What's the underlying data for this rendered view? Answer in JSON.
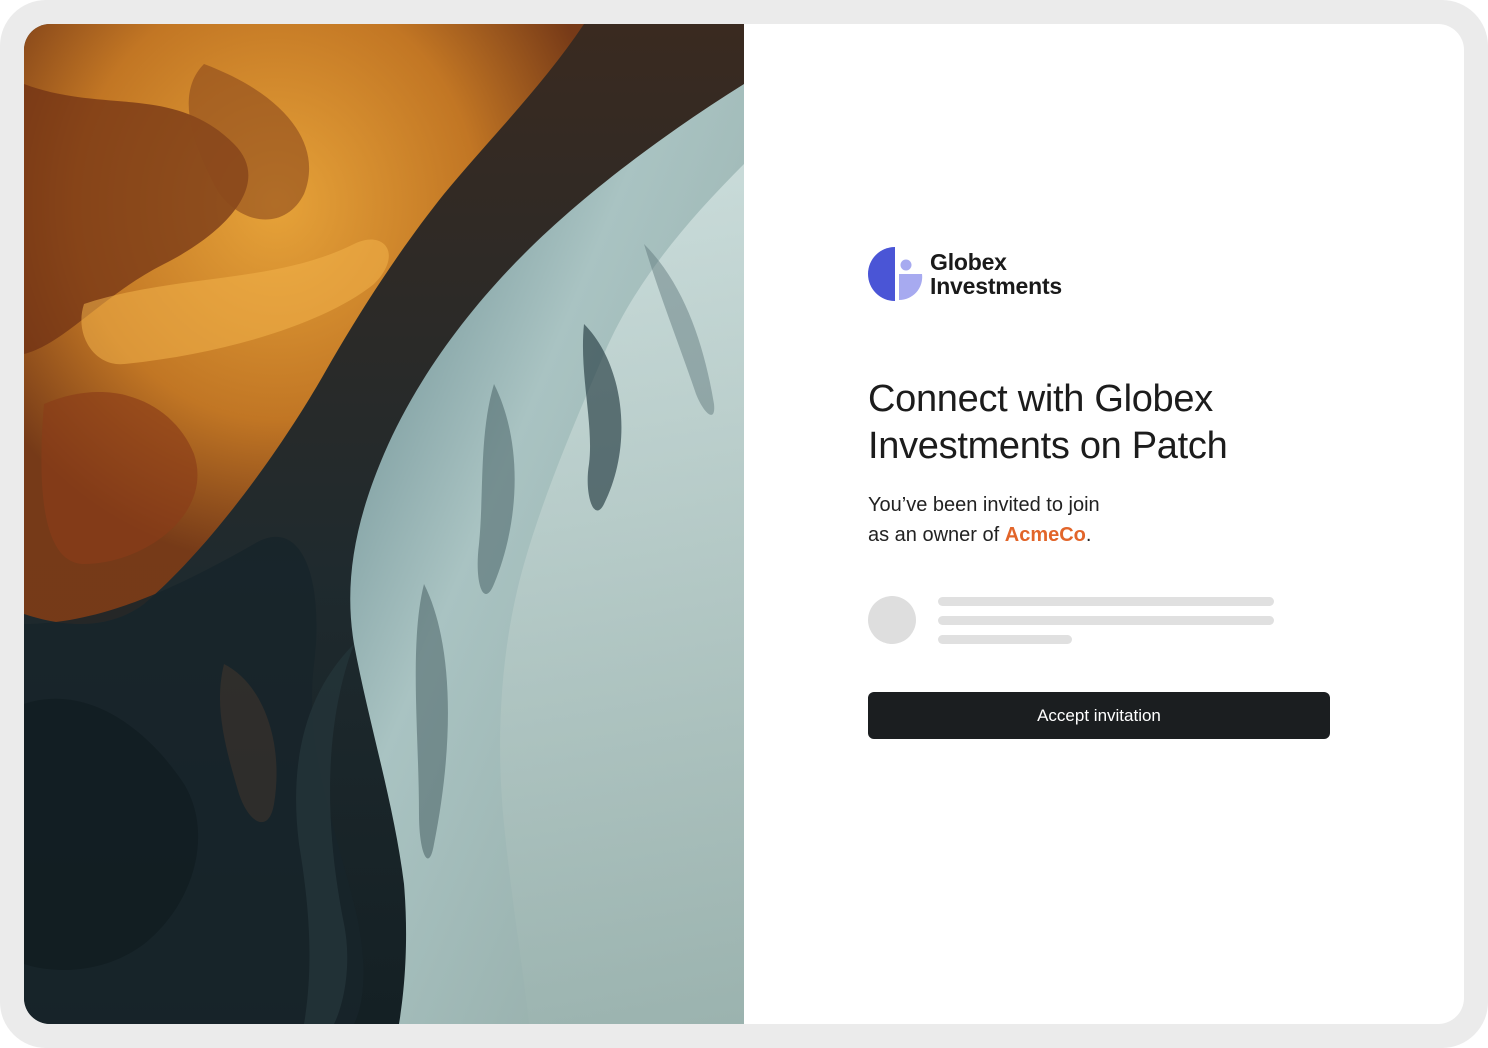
{
  "brand": {
    "name_line1": "Globex",
    "name_line2": "Investments",
    "logo_colors": {
      "primary": "#4a55d6",
      "secondary": "#a7aaf0"
    }
  },
  "hero_image": {
    "description_icon": "aerial-river-delta-photo",
    "colors": [
      "#e39a2a",
      "#7b3a1a",
      "#1e2d33",
      "#c9dad7",
      "#8fa7a6"
    ]
  },
  "invite": {
    "headline_line1": "Connect with Globex",
    "headline_line2": "Investments on Patch",
    "message_line1": "You’ve been invited to join",
    "message_prefix": "as an owner of ",
    "organization": "AcmeCo",
    "message_suffix": ".",
    "accent_color": "#e2652a"
  },
  "actions": {
    "accept_label": "Accept invitation",
    "accept_bg": "#1b1e20"
  }
}
